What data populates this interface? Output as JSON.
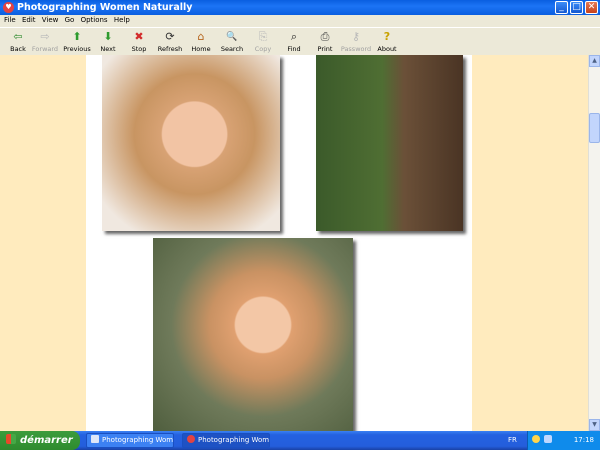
{
  "window": {
    "title": "Photographing Women Naturally"
  },
  "menu": [
    "File",
    "Edit",
    "View",
    "Go",
    "Options",
    "Help"
  ],
  "toolbar": [
    {
      "label": "Back",
      "icon": "back-arrow-icon",
      "enabled": true,
      "glyph": "⇦"
    },
    {
      "label": "Forward",
      "icon": "forward-arrow-icon",
      "enabled": false,
      "glyph": "⇨"
    },
    {
      "label": "Previous",
      "icon": "up-arrow-icon",
      "enabled": true,
      "glyph": "⬆"
    },
    {
      "label": "Next",
      "icon": "down-arrow-icon",
      "enabled": true,
      "glyph": "⬇"
    },
    {
      "label": "Stop",
      "icon": "stop-icon",
      "enabled": true,
      "glyph": "✖"
    },
    {
      "label": "Refresh",
      "icon": "refresh-icon",
      "enabled": true,
      "glyph": "⟳"
    },
    {
      "label": "Home",
      "icon": "home-icon",
      "enabled": true,
      "glyph": "⌂"
    },
    {
      "label": "Search",
      "icon": "search-icon",
      "enabled": true,
      "glyph": "🔍"
    },
    {
      "label": "Copy",
      "icon": "copy-icon",
      "enabled": false,
      "glyph": "⎘"
    },
    {
      "label": "Find",
      "icon": "binoculars-icon",
      "enabled": true,
      "glyph": "⌕"
    },
    {
      "label": "Print",
      "icon": "printer-icon",
      "enabled": true,
      "glyph": "⎙"
    },
    {
      "label": "Password",
      "icon": "key-icon",
      "enabled": false,
      "glyph": "⚷"
    },
    {
      "label": "About",
      "icon": "question-icon",
      "enabled": true,
      "glyph": "?"
    }
  ],
  "colors": {
    "content_background": "#FFEBBE",
    "center_background": "#FFFFFF",
    "titlebar": "#0A5EE0",
    "taskbar": "#245EDC"
  },
  "taskbar": {
    "start_label": "démarrer",
    "tasks": [
      {
        "label": "Photographing Wome..."
      },
      {
        "label": "Photographing Wome..."
      }
    ],
    "language": "FR",
    "clock": "17:18"
  }
}
